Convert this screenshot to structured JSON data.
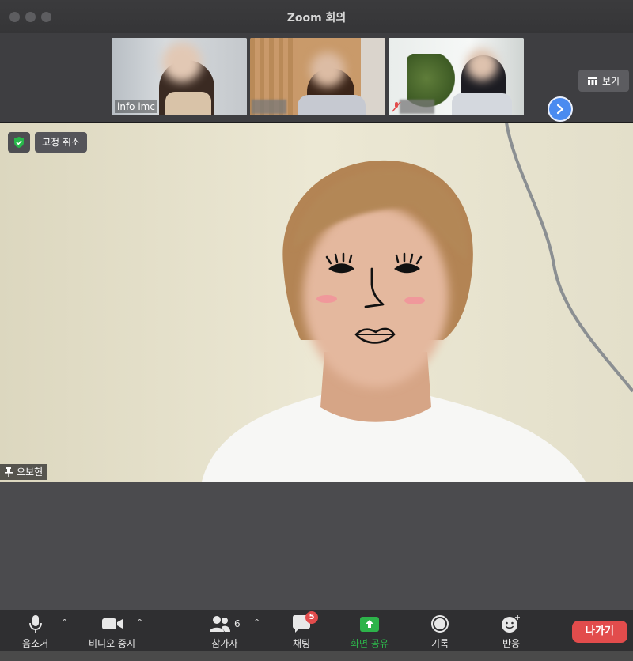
{
  "window": {
    "title": "Zoom 회의"
  },
  "gallery": {
    "thumbnails": [
      {
        "name": "info imc"
      },
      {
        "name": ""
      },
      {
        "name": ""
      }
    ],
    "view_label": "보기"
  },
  "main_video": {
    "unpin_label": "고정 취소",
    "speaker_name": "오보현"
  },
  "toolbar": {
    "mute_label": "음소거",
    "video_label": "비디오 중지",
    "participants_label": "참가자",
    "participants_count": "6",
    "chat_label": "채팅",
    "chat_badge": "5",
    "share_label": "화면 공유",
    "record_label": "기록",
    "reactions_label": "반응",
    "leave_label": "나가기"
  },
  "colors": {
    "accent_blue": "#4a8bf0",
    "share_green": "#2db34a",
    "leave_red": "#e24c4c",
    "shield_green": "#28b84a"
  },
  "icons": [
    "microphone-icon",
    "video-camera-icon",
    "participants-icon",
    "chat-icon",
    "share-screen-icon",
    "record-icon",
    "reaction-icon",
    "shield-icon",
    "pin-icon",
    "gallery-view-icon",
    "chevron-right-icon"
  ]
}
